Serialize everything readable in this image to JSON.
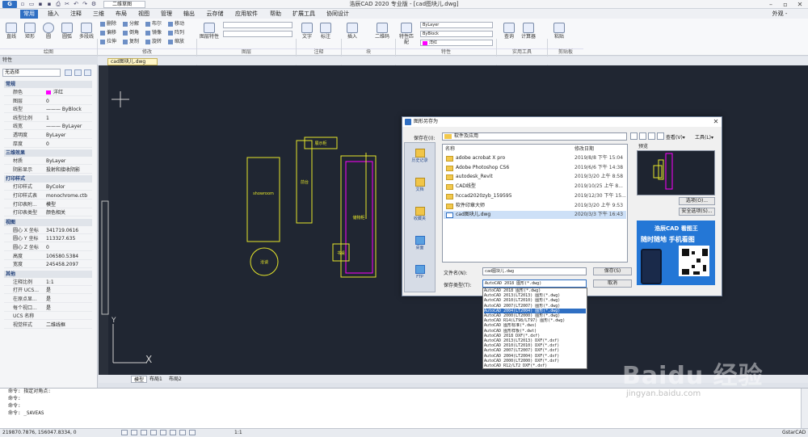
{
  "window": {
    "title": "浩辰CAD 2020 专业版 - [cad图块儿.dwg]",
    "workspace": "二维草图",
    "right_label": "外观 -"
  },
  "ribbon_tabs": [
    "常用",
    "插入",
    "注释",
    "三维",
    "布局",
    "视图",
    "管理",
    "输出",
    "云存储",
    "应用软件",
    "帮助",
    "扩展工具",
    "协同设计"
  ],
  "ribbon": {
    "groups": [
      "绘图",
      "修改",
      "图层",
      "注释",
      "块",
      "特性",
      "实用工具",
      "剪贴板"
    ],
    "draw_tools": [
      "直线",
      "矩形",
      "圆",
      "圆弧",
      "多段线"
    ],
    "modify_tools": [
      "删除",
      "分解",
      "布尔",
      "偏移",
      "倒角",
      "镜像",
      "拉伸",
      "复制",
      "旋转",
      "移动",
      "阵列",
      "缩放"
    ],
    "layer_props": "图层特性",
    "annot_tools": [
      "文字",
      "标注"
    ],
    "block_tools": [
      "插入",
      "二维码"
    ],
    "match_props": "特性匹配",
    "color_value": "洋红",
    "bylayer": "ByLayer",
    "byblock": "ByBlock",
    "util_tools": [
      "查询",
      "计算器"
    ],
    "clip_tools": [
      "粘贴"
    ]
  },
  "doc_tab": "cad图块儿.dwg",
  "properties": {
    "title": "特性",
    "selection": "无选择",
    "sections": [
      {
        "name": "常规",
        "rows": [
          [
            "颜色",
            "洋红"
          ],
          [
            "图层",
            "0"
          ],
          [
            "线型",
            "——— ByBlock"
          ],
          [
            "线型比例",
            "1"
          ],
          [
            "线宽",
            "——— ByLayer"
          ],
          [
            "透明度",
            "ByLayer"
          ],
          [
            "厚度",
            "0"
          ]
        ]
      },
      {
        "name": "三维效果",
        "rows": [
          [
            "材质",
            "ByLayer"
          ],
          [
            "阴影显示",
            "投射和接收阴影"
          ]
        ]
      },
      {
        "name": "打印样式",
        "rows": [
          [
            "打印样式",
            "ByColor"
          ],
          [
            "打印样式表",
            "monochrome.ctb"
          ],
          [
            "打印表附...",
            "模型"
          ],
          [
            "打印表类型",
            "颜色相关"
          ]
        ]
      },
      {
        "name": "视图",
        "rows": [
          [
            "圆心 X 坐标",
            "341719.0616"
          ],
          [
            "圆心 Y 坐标",
            "113327.635"
          ],
          [
            "圆心 Z 坐标",
            "0"
          ],
          [
            "高度",
            "106580.5384"
          ],
          [
            "宽度",
            "245458.2097"
          ]
        ]
      },
      {
        "name": "其他",
        "rows": [
          [
            "注释比例",
            "1:1"
          ],
          [
            "打开 UCS...",
            "是"
          ],
          [
            "在原点显...",
            "是"
          ],
          [
            "每个视口...",
            "是"
          ],
          [
            "UCS 名称",
            ""
          ],
          [
            "视觉样式",
            "二维线框"
          ]
        ]
      }
    ]
  },
  "drawing_labels": {
    "l1": "showroom",
    "l2": "前台",
    "l3": "展示柜",
    "l4": "洽谈",
    "l5": "储物柜",
    "l6": "书桌"
  },
  "layout_tabs": [
    "模型",
    "布局1",
    "布局2"
  ],
  "command_lines": [
    "命令: 指定对角点:",
    "命令:",
    "命令:",
    "命令: _SAVEAS"
  ],
  "status": {
    "coords": "219870.7876, 156047.8334, 0",
    "scale": "1:1",
    "app": "GstarCAD"
  },
  "dialog": {
    "title": "图形另存为",
    "save_in_label": "保存在(I):",
    "save_in_value": "软件及应用",
    "columns": [
      "名称",
      "修改日期"
    ],
    "files": [
      {
        "name": "adobe acrobat X pro",
        "date": "2019/8/8 下午 15:04"
      },
      {
        "name": "Adobe Photoshop CS6",
        "date": "2019/6/6 下午 14:38"
      },
      {
        "name": "autodesk_Revit",
        "date": "2019/3/20 上午 8:58"
      },
      {
        "name": "CAD线型",
        "date": "2019/10/25 上午 8..."
      },
      {
        "name": "hccad2020zyb_159595",
        "date": "2019/12/30 下午 15..."
      },
      {
        "name": "软件印章大师",
        "date": "2019/3/20 上午 9:53"
      },
      {
        "name": "cad图块儿.dwg",
        "date": "2020/3/3 下午 16:43"
      }
    ],
    "places": [
      "历史记录",
      "文档",
      "收藏夹",
      "桌面",
      "FTP"
    ],
    "preview_label": "预览",
    "view_menu": "查看(V)▾",
    "tools_menu": "工具(L)▾",
    "options_btn": "选项(O)...",
    "security_btn": "安全选项(S)...",
    "filename_label": "文件名(N):",
    "filename_value": "cad图块儿.dwg",
    "filetype_label": "保存类型(T):",
    "filetype_value": "AutoCAD 2018 图形(*.dwg)",
    "save_btn": "保存(S)",
    "cancel_btn": "取消",
    "filetypes": [
      "AutoCAD 2018 图形(*.dwg)",
      "AutoCAD 2013(LT2013) 图形(*.dwg)",
      "AutoCAD 2010(LT2010) 图形(*.dwg)",
      "AutoCAD 2007(LT2007) 图形(*.dwg)",
      "AutoCAD 2004(LT2004) 图形(*.dwg)",
      "AutoCAD 2000(LT2000) 图形(*.dwg)",
      "AutoCAD R14(LT98/LT97) 图形(*.dwg)",
      "AutoCAD 图形标准(*.dws)",
      "AutoCAD 图形样板(*.dwt)",
      "AutoCAD 2018 DXF(*.dxf)",
      "AutoCAD 2013(LT2013) DXF(*.dxf)",
      "AutoCAD 2010(LT2010) DXF(*.dxf)",
      "AutoCAD 2007(LT2007) DXF(*.dxf)",
      "AutoCAD 2004(LT2004) DXF(*.dxf)",
      "AutoCAD 2000(LT2000) DXF(*.dxf)",
      "AutoCAD R12/LT2 DXF(*.dxf)"
    ],
    "selected_filetype_index": 4,
    "ad": {
      "brand": "浩辰CAD 看图王",
      "slogan": "随时随地 手机看图"
    }
  },
  "watermark": {
    "main": "Baidu 经验",
    "sub": "jingyan.baidu.com"
  },
  "colors": {
    "accent": "#2f6fc3",
    "magenta": "#ff00ff",
    "yellow": "#e6e62a"
  }
}
